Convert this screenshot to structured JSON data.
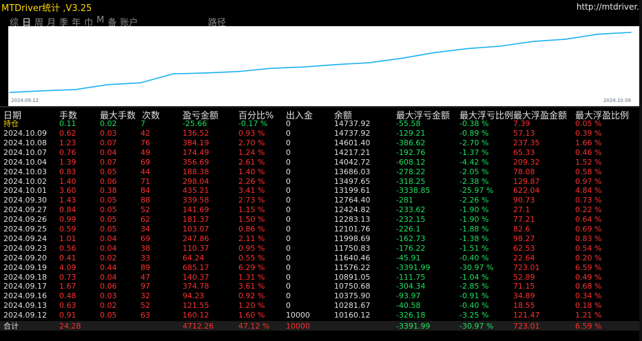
{
  "app_title": "MTDriver统计 ,V3.25",
  "url": "http://mtdriver.",
  "tabs": [
    "综",
    "日",
    "周",
    "月",
    "季",
    "年",
    "巾",
    "M",
    "备",
    "账户"
  ],
  "active_tab": "日",
  "path_label": "路径",
  "chart_data": {
    "type": "line",
    "x_start": "2024.09.12",
    "x_end": "2024.10.09",
    "series": [
      {
        "values": [
          10160.12,
          10281.67,
          10375.9,
          10750.68,
          10891.05,
          11576.22,
          11640.46,
          11750.83,
          11998.69,
          12101.76,
          12283.13,
          12424.82,
          12764.4,
          13199.61,
          13497.65,
          13686.03,
          14042.72,
          14217.21,
          14601.4,
          14737.92
        ]
      }
    ],
    "ylim": [
      9800,
      15000
    ],
    "grid": false
  },
  "headers": [
    "日期",
    "手数",
    "最大手数",
    "次数",
    "盈亏金额",
    "百分比%",
    "出入金",
    "余额",
    "最大浮亏金额",
    "最大浮亏比例",
    "最大浮盈金额",
    "最大浮盈比例"
  ],
  "position_row": {
    "date": "持仓",
    "lots": "0.11",
    "maxlots": "0.02",
    "count": "7",
    "pl": "-25.66",
    "pct": "-0.17 %",
    "io": "0",
    "bal": "14737.92",
    "mfl": "-55.58",
    "mflp": "-0.38 %",
    "mfp": "7.39",
    "mfpp": "0.05 %"
  },
  "rows": [
    {
      "date": "2024.10.09",
      "lots": "0.62",
      "maxlots": "0.03",
      "count": "42",
      "pl": "136.52",
      "pct": "0.93 %",
      "io": "0",
      "bal": "14737.92",
      "mfl": "-129.21",
      "mflp": "-0.89 %",
      "mfp": "57.13",
      "mfpp": "0.39 %"
    },
    {
      "date": "2024.10.08",
      "lots": "1.23",
      "maxlots": "0.07",
      "count": "76",
      "pl": "384.19",
      "pct": "2.70 %",
      "io": "0",
      "bal": "14601.40",
      "mfl": "-386.62",
      "mflp": "-2.70 %",
      "mfp": "237.35",
      "mfpp": "1.66 %"
    },
    {
      "date": "2024.10.07",
      "lots": "0.76",
      "maxlots": "0.04",
      "count": "49",
      "pl": "174.49",
      "pct": "1.24 %",
      "io": "0",
      "bal": "14217.21",
      "mfl": "-192.76",
      "mflp": "-1.37 %",
      "mfp": "65.33",
      "mfpp": "0.46 %"
    },
    {
      "date": "2024.10.04",
      "lots": "1.39",
      "maxlots": "0.07",
      "count": "69",
      "pl": "356.69",
      "pct": "2.61 %",
      "io": "0",
      "bal": "14042.72",
      "mfl": "-608.12",
      "mflp": "-4.42 %",
      "mfp": "209.32",
      "mfpp": "1.52 %"
    },
    {
      "date": "2024.10.03",
      "lots": "0.83",
      "maxlots": "0.05",
      "count": "44",
      "pl": "188.38",
      "pct": "1.40 %",
      "io": "0",
      "bal": "13686.03",
      "mfl": "-278.22",
      "mflp": "-2.05 %",
      "mfp": "78.08",
      "mfpp": "0.58 %"
    },
    {
      "date": "2024.10.02",
      "lots": "1.40",
      "maxlots": "0.06",
      "count": "71",
      "pl": "298.04",
      "pct": "2.26 %",
      "io": "0",
      "bal": "13497.65",
      "mfl": "-318.25",
      "mflp": "-2.38 %",
      "mfp": "129.87",
      "mfpp": "0.97 %"
    },
    {
      "date": "2024.10.01",
      "lots": "3.60",
      "maxlots": "0.38",
      "count": "84",
      "pl": "435.21",
      "pct": "3.41 %",
      "io": "0",
      "bal": "13199.61",
      "mfl": "-3338.85",
      "mflp": "-25.97 %",
      "mfp": "622.04",
      "mfpp": "4.84 %"
    },
    {
      "date": "2024.09.30",
      "lots": "1.43",
      "maxlots": "0.05",
      "count": "88",
      "pl": "339.58",
      "pct": "2.73 %",
      "io": "0",
      "bal": "12764.40",
      "mfl": "-281",
      "mflp": "-2.26 %",
      "mfp": "90.73",
      "mfpp": "0.73 %"
    },
    {
      "date": "2024.09.27",
      "lots": "0.84",
      "maxlots": "0.05",
      "count": "52",
      "pl": "141.69",
      "pct": "1.15 %",
      "io": "0",
      "bal": "12424.82",
      "mfl": "-233.62",
      "mflp": "-1.90 %",
      "mfp": "27.1",
      "mfpp": "0.22 %"
    },
    {
      "date": "2024.09.26",
      "lots": "0.99",
      "maxlots": "0.05",
      "count": "62",
      "pl": "181.37",
      "pct": "1.50 %",
      "io": "0",
      "bal": "12283.13",
      "mfl": "-232.15",
      "mflp": "-1.90 %",
      "mfp": "77.21",
      "mfpp": "0.64 %"
    },
    {
      "date": "2024.09.25",
      "lots": "0.59",
      "maxlots": "0.05",
      "count": "34",
      "pl": "103.07",
      "pct": "0.86 %",
      "io": "0",
      "bal": "12101.76",
      "mfl": "-226.1",
      "mflp": "-1.88 %",
      "mfp": "82.6",
      "mfpp": "0.69 %"
    },
    {
      "date": "2024.09.24",
      "lots": "1.01",
      "maxlots": "0.04",
      "count": "69",
      "pl": "247.86",
      "pct": "2.11 %",
      "io": "0",
      "bal": "11998.69",
      "mfl": "-162.73",
      "mflp": "-1.38 %",
      "mfp": "98.27",
      "mfpp": "0.83 %"
    },
    {
      "date": "2024.09.23",
      "lots": "0.56",
      "maxlots": "0.04",
      "count": "38",
      "pl": "110.37",
      "pct": "0.95 %",
      "io": "0",
      "bal": "11750.83",
      "mfl": "-176.22",
      "mflp": "-1.51 %",
      "mfp": "62.53",
      "mfpp": "0.54 %"
    },
    {
      "date": "2024.09.20",
      "lots": "0.41",
      "maxlots": "0.02",
      "count": "33",
      "pl": "64.24",
      "pct": "0.55 %",
      "io": "0",
      "bal": "11640.46",
      "mfl": "-45.91",
      "mflp": "-0.40 %",
      "mfp": "22.64",
      "mfpp": "0.20 %"
    },
    {
      "date": "2024.09.19",
      "lots": "4.09",
      "maxlots": "0.44",
      "count": "89",
      "pl": "685.17",
      "pct": "6.29 %",
      "io": "0",
      "bal": "11576.22",
      "mfl": "-3391.99",
      "mflp": "-30.97 %",
      "mfp": "723.01",
      "mfpp": "6.59 %"
    },
    {
      "date": "2024.09.18",
      "lots": "0.73",
      "maxlots": "0.04",
      "count": "47",
      "pl": "140.37",
      "pct": "1.31 %",
      "io": "0",
      "bal": "10891.05",
      "mfl": "-111.75",
      "mflp": "-1.04 %",
      "mfp": "52.89",
      "mfpp": "0.49 %"
    },
    {
      "date": "2024.09.17",
      "lots": "1.67",
      "maxlots": "0.06",
      "count": "97",
      "pl": "374.78",
      "pct": "3.61 %",
      "io": "0",
      "bal": "10750.68",
      "mfl": "-304.34",
      "mflp": "-2.85 %",
      "mfp": "71.15",
      "mfpp": "0.68 %"
    },
    {
      "date": "2024.09.16",
      "lots": "0.48",
      "maxlots": "0.03",
      "count": "32",
      "pl": "94.23",
      "pct": "0.92 %",
      "io": "0",
      "bal": "10375.90",
      "mfl": "-93.97",
      "mflp": "-0.91 %",
      "mfp": "34.89",
      "mfpp": "0.34 %"
    },
    {
      "date": "2024.09.13",
      "lots": "0.63",
      "maxlots": "0.02",
      "count": "52",
      "pl": "121.55",
      "pct": "1.20 %",
      "io": "0",
      "bal": "10281.67",
      "mfl": "-40.58",
      "mflp": "-0.40 %",
      "mfp": "18.55",
      "mfpp": "0.18 %"
    },
    {
      "date": "2024.09.12",
      "lots": "0.91",
      "maxlots": "0.05",
      "count": "63",
      "pl": "160.12",
      "pct": "1.60 %",
      "io": "10000",
      "bal": "10160.12",
      "mfl": "-326.18",
      "mflp": "-3.25 %",
      "mfp": "121.47",
      "mfpp": "1.21 %"
    }
  ],
  "total_row": {
    "date": "合计",
    "lots": "24.28",
    "maxlots": "",
    "count": "",
    "pl": "4712.26",
    "pct": "47.12 %",
    "io": "10000",
    "bal": "",
    "mfl": "-3391.99",
    "mflp": "-30.97 %",
    "mfp": "723.01",
    "mfpp": "6.59 %"
  },
  "colors": {
    "title": "#ffd700",
    "line": "#1ab0f0",
    "positive": "#ff3030",
    "negative": "#20e060",
    "highlight": "#ffd700"
  }
}
